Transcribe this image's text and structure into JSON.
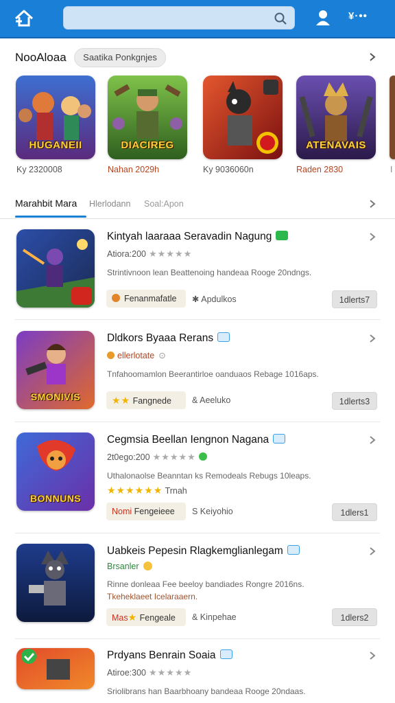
{
  "header": {
    "home_icon": "home-icon",
    "search_placeholder": "",
    "search_icon": "search-icon",
    "user_icon": "user-icon",
    "menu_label": "¥·••"
  },
  "featured": {
    "title": "NooAloaa",
    "chip_label": "Saatika Ponkgnjes",
    "cards": [
      {
        "art_title": "HUGANEII",
        "caption": "Ky 2320008",
        "caption_color": "#555555"
      },
      {
        "art_title": "DIACIREG",
        "caption": "Nahan 2029h",
        "caption_color": "#b5431f"
      },
      {
        "art_title": "",
        "caption": "Ky 9036060n",
        "caption_color": "#555555"
      },
      {
        "art_title": "ATENAVAIS",
        "caption": "Raden 2830",
        "caption_color": "#b5431f"
      }
    ],
    "partial_caption": "I"
  },
  "tabs": {
    "active": "Marahbit Mara",
    "tab2": "Hlerlodann",
    "tab3": "Soal:Apon"
  },
  "items": [
    {
      "title": "Kintyah laaraaa Seravadin Nagung",
      "meta": "Atiora:200",
      "stars": "★★★★★",
      "desc": "Strintivnoon lean Beattenoing handeaa Rooge 20ndngs.",
      "desc2": "",
      "pill": "Fenanmafatle",
      "pill_prefix": "",
      "category": "✱  Apdulkos",
      "button": "1dlerts7",
      "art_title": "",
      "badge_color": "#2db84d"
    },
    {
      "title": "Dldkors Byaaa Rerans",
      "meta": "ellerlotate",
      "stars": "",
      "desc": "Tnfahoomamlon Beerantirloe oanduaos Rebage 1016aps.",
      "desc2": "",
      "pill": "Fangnede",
      "pill_prefix": "",
      "category": "& Aeeluko",
      "button": "1dlerts3",
      "art_title": "SMONIVIS",
      "badge_color": "#3aa0e8"
    },
    {
      "title": "Cegmsia Beellan Iengnon Nagana",
      "meta": "2t0ego:200",
      "stars": "★★★★★",
      "desc": "Uthalonaolse Beanntan ks Remodeals Rebugs 10leaps.",
      "desc2": "",
      "pill": "Fengeieee",
      "pill_prefix": "Nomi",
      "category": "S Keiyohio",
      "button": "1dlers1",
      "art_title": "BONNUNS",
      "badge_color": "#3aa0e8",
      "extra_stars": "★★★★★★",
      "extra_label": "Trnah"
    },
    {
      "title": "Uabkeis Pepesin Rlagkemglianlegam",
      "meta": "Brsanler",
      "stars": "",
      "desc": "Rinne donleaa Fee beeloy bandiades Rongre 2016ns.",
      "desc2": "Tkeheklaeet Icelaraaern.",
      "pill": "Fengeale",
      "pill_prefix": "Mas",
      "category": "& Kinpehae",
      "button": "1dlers2",
      "art_title": "",
      "badge_color": "#3aa0e8"
    },
    {
      "title": "Prdyans Benrain Soaia",
      "meta": "Atiroe:300",
      "stars": "★★★★★",
      "desc": "Sriolibrans han Baarbhoany bandeaa Rooge 20ndaas.",
      "desc2": "",
      "pill": "",
      "pill_prefix": "",
      "category": "",
      "button": "",
      "art_title": "",
      "badge_color": "#3aa0e8"
    }
  ],
  "colors": {
    "brand": "#1a7fd6",
    "accent_orange": "#b5431f",
    "star_gold": "#f3b400"
  }
}
